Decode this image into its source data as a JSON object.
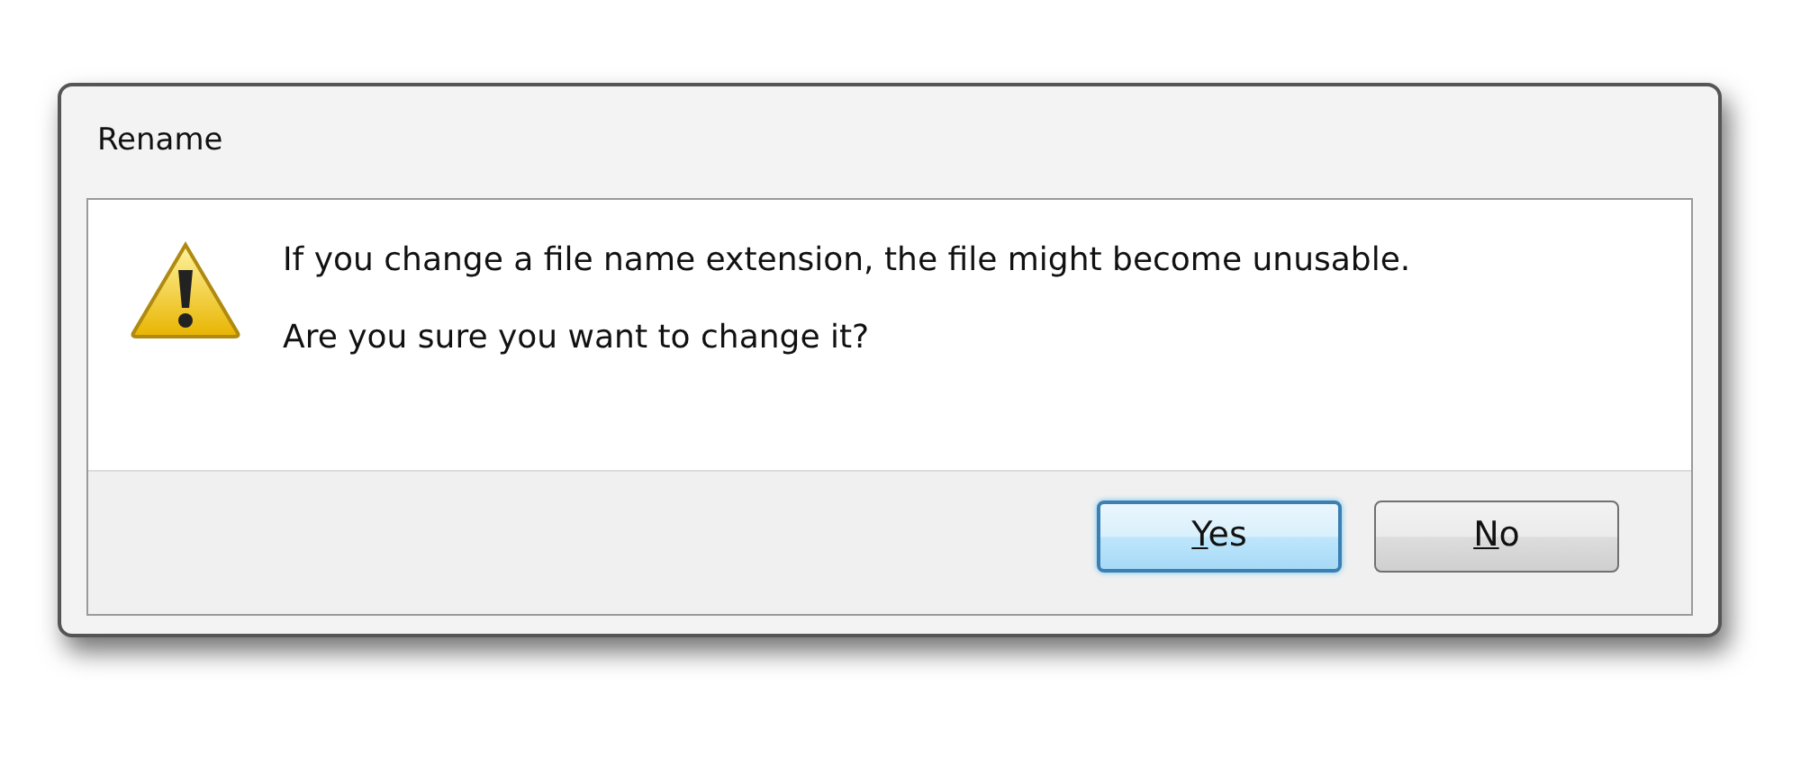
{
  "window": {
    "title": "Rename"
  },
  "message": {
    "lines": [
      "If you change a file name extension, the file might become unusable.",
      "Are you sure you want to change it?"
    ]
  },
  "buttons": [
    {
      "mnemonic": "Y",
      "rest": "es",
      "default": true
    },
    {
      "mnemonic": "N",
      "rest": "o",
      "default": false
    }
  ]
}
